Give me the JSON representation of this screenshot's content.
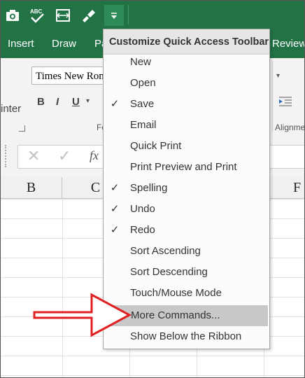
{
  "tabs": [
    "Insert",
    "Draw",
    "Pa",
    "Review"
  ],
  "ribbon": {
    "font_name": "Times New Roman",
    "painter": "inter",
    "bold": "B",
    "italic": "I",
    "underline": "U",
    "font_group": "Fo",
    "alignment_group": "Alignme"
  },
  "formula_bar": {
    "cancel": "✕",
    "enter": "✓",
    "fx": "fx"
  },
  "columns": [
    "B",
    "C",
    "F"
  ],
  "menu": {
    "title": "Customize Quick Access Toolbar",
    "items": [
      {
        "label": "New",
        "checked": false
      },
      {
        "label": "Open",
        "checked": false
      },
      {
        "label": "Save",
        "checked": true
      },
      {
        "label": "Email",
        "checked": false
      },
      {
        "label": "Quick Print",
        "checked": false
      },
      {
        "label": "Print Preview and Print",
        "checked": false
      },
      {
        "label": "Spelling",
        "checked": true
      },
      {
        "label": "Undo",
        "checked": true
      },
      {
        "label": "Redo",
        "checked": true
      },
      {
        "label": "Sort Ascending",
        "checked": false
      },
      {
        "label": "Sort Descending",
        "checked": false
      },
      {
        "label": "Touch/Mouse Mode",
        "checked": false
      },
      {
        "label": "More Commands...",
        "checked": false,
        "highlighted": true
      },
      {
        "label": "Show Below the Ribbon",
        "checked": false
      }
    ],
    "check_glyph": "✓"
  },
  "colors": {
    "excel_green": "#217346",
    "arrow_red": "#e02020",
    "highlight": "#c8c8c8"
  }
}
